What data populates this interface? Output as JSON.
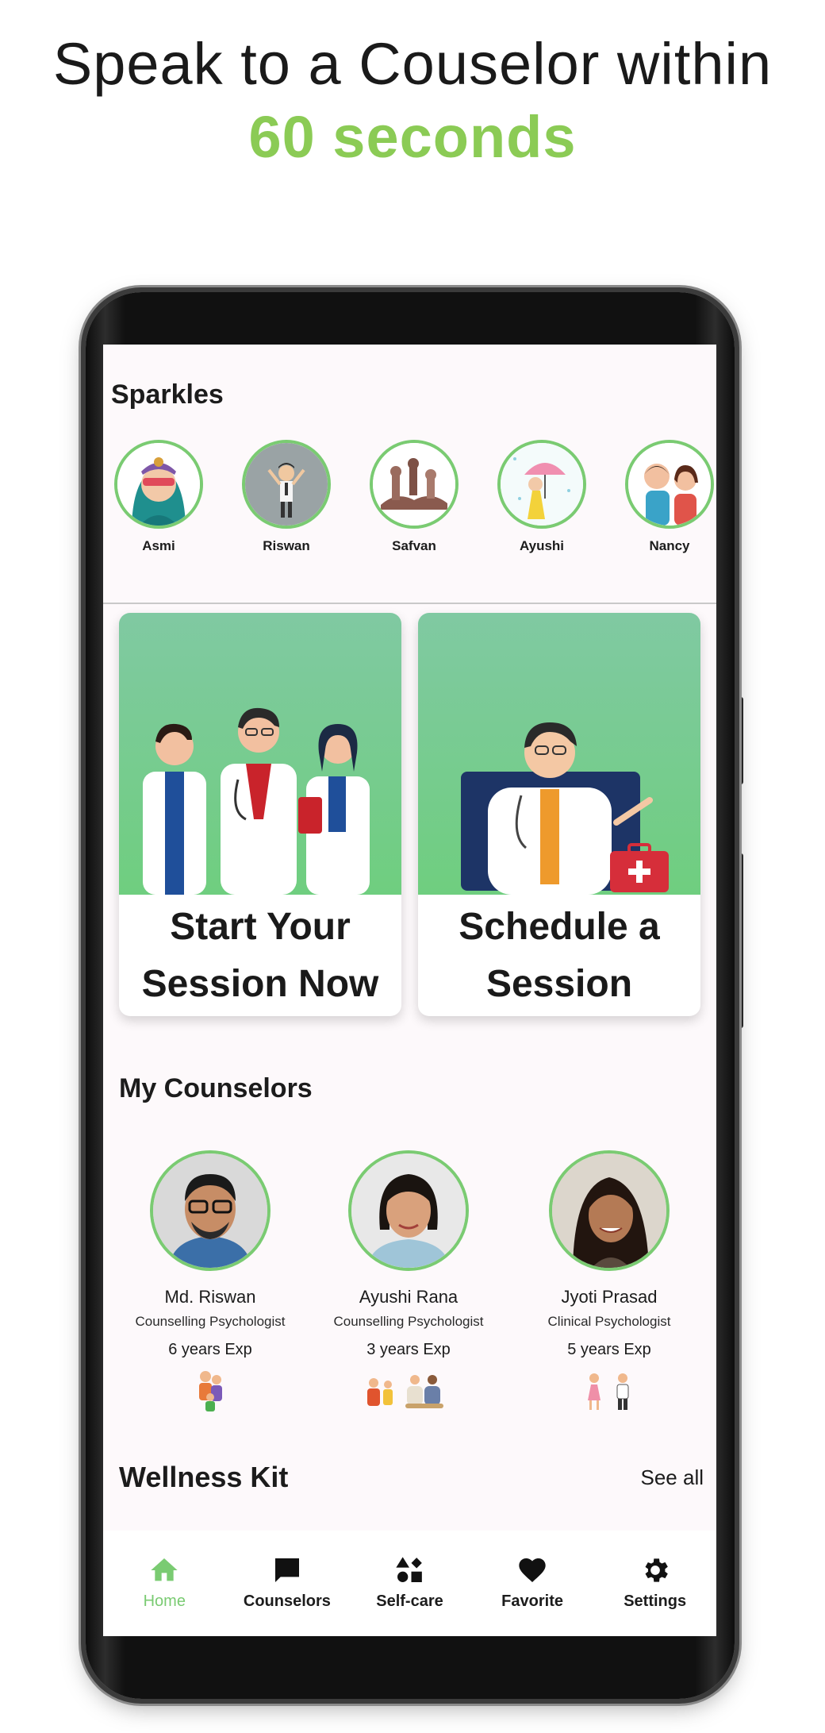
{
  "headline": {
    "line1": "Speak to a Couselor within",
    "line2": "60 seconds",
    "accent_color": "#8bcb55"
  },
  "sparkles": {
    "title": "Sparkles",
    "items": [
      {
        "name": "Asmi",
        "icon": "girl-avatar-icon"
      },
      {
        "name": "Riswan",
        "icon": "man-avatar-icon"
      },
      {
        "name": "Safvan",
        "icon": "figures-avatar-icon"
      },
      {
        "name": "Ayushi",
        "icon": "umbrella-girl-icon"
      },
      {
        "name": "Nancy",
        "icon": "kids-avatar-icon"
      }
    ],
    "ring_color": "#7acb72"
  },
  "actions": [
    {
      "label": "Start Your Session Now",
      "icon": "doctors-team-illustration"
    },
    {
      "label": "Schedule a Session",
      "icon": "doctor-laptop-illustration"
    }
  ],
  "counselors": {
    "title": "My Counselors",
    "items": [
      {
        "name": "Md. Riswan",
        "role": "Counselling Psychologist",
        "exp": "6 years Exp"
      },
      {
        "name": "Ayushi Rana",
        "role": "Counselling Psychologist",
        "exp": "3 years Exp"
      },
      {
        "name": "Jyoti Prasad",
        "role": "Clinical Psychologist",
        "exp": "5 years Exp"
      }
    ]
  },
  "wellness": {
    "title": "Wellness Kit",
    "see_all": "See all"
  },
  "nav": {
    "items": [
      {
        "label": "Home",
        "icon": "home-icon",
        "active": true
      },
      {
        "label": "Counselors",
        "icon": "chat-icon",
        "active": false
      },
      {
        "label": "Self-care",
        "icon": "shapes-icon",
        "active": false
      },
      {
        "label": "Favorite",
        "icon": "heart-icon",
        "active": false
      },
      {
        "label": "Settings",
        "icon": "gear-icon",
        "active": false
      }
    ],
    "active_color": "#7acb72"
  }
}
